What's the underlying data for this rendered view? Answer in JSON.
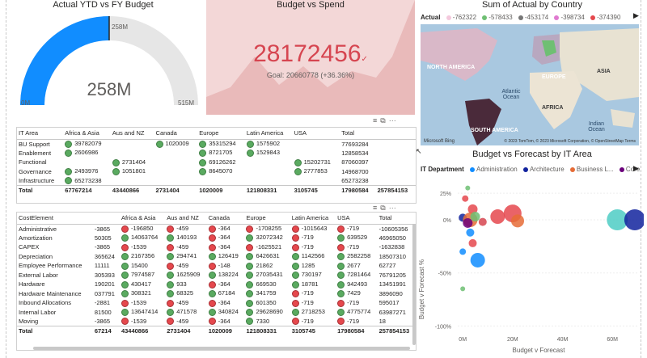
{
  "gauge": {
    "title": "Actual YTD vs FY Budget",
    "value": "258M",
    "target_label": "258M",
    "min_label": "0M",
    "max_label": "515M",
    "fraction": 0.5
  },
  "kpi": {
    "title": "Budget vs Spend",
    "value": "28172456",
    "goal_text": "Goal: 20660778 (+36.36%)"
  },
  "map": {
    "title": "Sum of Actual by Country",
    "legend_label": "Actual",
    "legend_items": [
      {
        "label": "-762322",
        "color": "#f4c9dd"
      },
      {
        "label": "-578433",
        "color": "#6fbf73"
      },
      {
        "label": "-453174",
        "color": "#777777"
      },
      {
        "label": "-398734",
        "color": "#e07ad0"
      },
      {
        "label": "-374390",
        "color": "#e5484d"
      }
    ],
    "labels": {
      "north_america": "NORTH AMERICA",
      "europe": "EUROPE",
      "asia": "ASIA",
      "africa": "AFRICA",
      "south_america": "SOUTH AMERICA",
      "atlantic": "Atlantic Ocean",
      "indian": "Indian Ocean"
    },
    "bing": "Microsoft Bing",
    "attribution": "© 2023 TomTom, © 2023 Microsoft Corporation, © OpenStreetMap Terms"
  },
  "table1": {
    "headers": [
      "IT Area",
      "Africa & Asia",
      "Aus and NZ",
      "Canada",
      "Europe",
      "Latin America",
      "USA",
      "Total"
    ],
    "rows": [
      {
        "label": "BU Support",
        "cells": [
          [
            "g",
            "39782079"
          ],
          [
            "",
            ""
          ],
          [
            "g",
            "1020009"
          ],
          [
            "g",
            "35315294"
          ],
          [
            "g",
            "1575902"
          ],
          [
            "",
            ""
          ]
        ],
        "total": "77693284"
      },
      {
        "label": "Enablement",
        "cells": [
          [
            "g",
            "2606986"
          ],
          [
            "",
            ""
          ],
          [
            "",
            ""
          ],
          [
            "g",
            "8721705"
          ],
          [
            "g",
            "1529843"
          ],
          [
            "",
            ""
          ]
        ],
        "total": "12858534"
      },
      {
        "label": "Functional",
        "cells": [
          [
            "",
            ""
          ],
          [
            "g",
            "2731404"
          ],
          [
            "",
            ""
          ],
          [
            "g",
            "69126262"
          ],
          [
            "",
            ""
          ],
          [
            "g",
            "15202731"
          ]
        ],
        "total": "87060397"
      },
      {
        "label": "Governance",
        "cells": [
          [
            "g",
            "2493976"
          ],
          [
            "g",
            "1051801"
          ],
          [
            "",
            ""
          ],
          [
            "g",
            "8645070"
          ],
          [
            "",
            ""
          ],
          [
            "g",
            "2777853"
          ]
        ],
        "total": "14968700"
      },
      {
        "label": "Infrastructure",
        "cells": [
          [
            "g",
            "65273238"
          ],
          [
            "",
            ""
          ],
          [
            "",
            ""
          ],
          [
            "",
            ""
          ],
          [
            "",
            ""
          ],
          [
            "",
            ""
          ]
        ],
        "total": "65273238"
      }
    ],
    "total_row": {
      "label": "Total",
      "values": [
        "67767214",
        "43440866",
        "2731404",
        "1020009",
        "121808331",
        "3105745",
        "17980584"
      ],
      "total": "257854153"
    }
  },
  "table2": {
    "headers": [
      "CostElement",
      "",
      "Africa & Asia",
      "Aus and NZ",
      "Canada",
      "Europe",
      "Latin America",
      "USA",
      "Total"
    ],
    "rows": [
      {
        "label": "Administrative",
        "first": "-3865",
        "cells": [
          [
            "r",
            "-196850"
          ],
          [
            "r",
            "-459"
          ],
          [
            "r",
            "-364"
          ],
          [
            "r",
            "-1708255"
          ],
          [
            "r",
            "-1015643"
          ],
          [
            "r",
            "-719"
          ]
        ],
        "total": "-10605356"
      },
      {
        "label": "Amortization",
        "first": "50305",
        "cells": [
          [
            "g",
            "14063764"
          ],
          [
            "g",
            "140193"
          ],
          [
            "r",
            "-364"
          ],
          [
            "g",
            "32072342"
          ],
          [
            "r",
            "-719"
          ],
          [
            "g",
            "639529"
          ]
        ],
        "total": "46965050"
      },
      {
        "label": "CAPEX",
        "first": "-3865",
        "cells": [
          [
            "r",
            "-1539"
          ],
          [
            "r",
            "-459"
          ],
          [
            "r",
            "-364"
          ],
          [
            "r",
            "-1625521"
          ],
          [
            "r",
            "-719"
          ],
          [
            "r",
            "-719"
          ]
        ],
        "total": "-1632838"
      },
      {
        "label": "Depreciation",
        "first": "365624",
        "cells": [
          [
            "g",
            "2167356"
          ],
          [
            "g",
            "294741"
          ],
          [
            "g",
            "126419"
          ],
          [
            "g",
            "6426631"
          ],
          [
            "g",
            "1142566"
          ],
          [
            "g",
            "2582258"
          ]
        ],
        "total": "18507310"
      },
      {
        "label": "Employee Performance",
        "first": "11111",
        "cells": [
          [
            "g",
            "15400"
          ],
          [
            "r",
            "-459"
          ],
          [
            "r",
            "-148"
          ],
          [
            "g",
            "21862"
          ],
          [
            "g",
            "1285"
          ],
          [
            "g",
            "2677"
          ]
        ],
        "total": "62727"
      },
      {
        "label": "External Labor",
        "first": "305393",
        "cells": [
          [
            "g",
            "7974587"
          ],
          [
            "g",
            "1625909"
          ],
          [
            "g",
            "138224"
          ],
          [
            "g",
            "27035431"
          ],
          [
            "g",
            "730197"
          ],
          [
            "g",
            "7281464"
          ]
        ],
        "total": "76791205"
      },
      {
        "label": "Hardware",
        "first": "190201",
        "cells": [
          [
            "g",
            "430417"
          ],
          [
            "g",
            "933"
          ],
          [
            "r",
            "-364"
          ],
          [
            "g",
            "669530"
          ],
          [
            "g",
            "18781"
          ],
          [
            "g",
            "942493"
          ]
        ],
        "total": "13451991"
      },
      {
        "label": "Hardware Maintenance",
        "first": "037791",
        "cells": [
          [
            "g",
            "308321"
          ],
          [
            "g",
            "68325"
          ],
          [
            "g",
            "67184"
          ],
          [
            "g",
            "341759"
          ],
          [
            "r",
            "-719"
          ],
          [
            "g",
            "7429"
          ]
        ],
        "total": "3896090"
      },
      {
        "label": "Inbound Allocations",
        "first": "-2881",
        "cells": [
          [
            "r",
            "-1539"
          ],
          [
            "r",
            "-459"
          ],
          [
            "r",
            "-364"
          ],
          [
            "g",
            "601350"
          ],
          [
            "r",
            "-719"
          ],
          [
            "r",
            "-719"
          ]
        ],
        "total": "595017"
      },
      {
        "label": "Internal Labor",
        "first": "81500",
        "cells": [
          [
            "g",
            "13647414"
          ],
          [
            "g",
            "471578"
          ],
          [
            "g",
            "340824"
          ],
          [
            "g",
            "29628690"
          ],
          [
            "g",
            "2718253"
          ],
          [
            "g",
            "4775774"
          ]
        ],
        "total": "63987271"
      },
      {
        "label": "Moving",
        "first": "-3865",
        "cells": [
          [
            "r",
            "-1539"
          ],
          [
            "r",
            "-459"
          ],
          [
            "r",
            "-364"
          ],
          [
            "g",
            "7330"
          ],
          [
            "r",
            "-719"
          ],
          [
            "r",
            "-719"
          ]
        ],
        "total": "18"
      }
    ],
    "total_row": {
      "label": "Total",
      "first": "67214",
      "values": [
        "43440866",
        "2731404",
        "1020009",
        "121808331",
        "3105745",
        "17980584"
      ],
      "total": "257854153"
    }
  },
  "scatter": {
    "title": "Budget vs Forecast by IT Area",
    "legend_label": "IT Department",
    "legend_items": [
      {
        "label": "Administration",
        "color": "#118dff"
      },
      {
        "label": "Architecture",
        "color": "#12239e"
      },
      {
        "label": "Business L...",
        "color": "#e66c37"
      },
      {
        "label": "Core",
        "color": "#6b007b"
      }
    ],
    "xlabel": "Budget v Forecast",
    "ylabel": "Budget v Forecast %",
    "xticks": [
      "0M",
      "20M",
      "40M",
      "60M"
    ],
    "yticks": [
      "25%",
      "0%",
      "-50%",
      "-100%"
    ]
  },
  "chart_data": {
    "type": "scatter",
    "title": "Budget vs Forecast by IT Area",
    "xlabel": "Budget v Forecast",
    "ylabel": "Budget v Forecast %",
    "xlim": [
      -2,
      70
    ],
    "ylim": [
      -105,
      35
    ],
    "x_unit": "M",
    "y_unit": "%",
    "points": [
      {
        "x": 1,
        "y": 20,
        "r": 4,
        "color": "#e5484d"
      },
      {
        "x": 4,
        "y": 10,
        "r": 6,
        "color": "#e5484d"
      },
      {
        "x": 2,
        "y": 30,
        "r": 3,
        "color": "#6fbf73"
      },
      {
        "x": 0,
        "y": 2,
        "r": 5,
        "color": "#12239e"
      },
      {
        "x": 3,
        "y": 0,
        "r": 9,
        "color": "#e66c37"
      },
      {
        "x": 5,
        "y": 3,
        "r": 6,
        "color": "#6fbf73"
      },
      {
        "x": 2,
        "y": -3,
        "r": 6,
        "color": "#6b007b"
      },
      {
        "x": 8,
        "y": -2,
        "r": 5,
        "color": "#d64550"
      },
      {
        "x": 14,
        "y": 3,
        "r": 9,
        "color": "#e5484d"
      },
      {
        "x": 20,
        "y": 6,
        "r": 11,
        "color": "#e5484d"
      },
      {
        "x": 22,
        "y": -1,
        "r": 8,
        "color": "#e66c37"
      },
      {
        "x": 3,
        "y": -12,
        "r": 5,
        "color": "#118dff"
      },
      {
        "x": 4,
        "y": -22,
        "r": 5,
        "color": "#e5484d"
      },
      {
        "x": 0,
        "y": -30,
        "r": 4,
        "color": "#118dff"
      },
      {
        "x": 6,
        "y": -38,
        "r": 9,
        "color": "#118dff"
      },
      {
        "x": 0,
        "y": -65,
        "r": 3,
        "color": "#6fbf73"
      },
      {
        "x": 62,
        "y": 0,
        "r": 13,
        "color": "#4ecdc4"
      },
      {
        "x": 69,
        "y": 0,
        "r": 13,
        "color": "#12239e"
      }
    ]
  }
}
